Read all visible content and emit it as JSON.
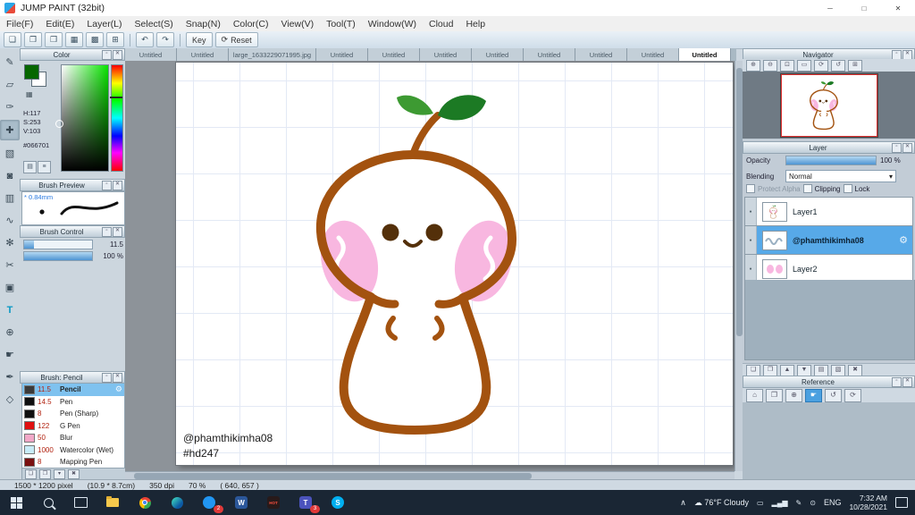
{
  "window": {
    "title": "JUMP PAINT (32bit)",
    "minimize_icon": "─",
    "maximize_icon": "□",
    "close_icon": "✕"
  },
  "panel": {
    "collapse_icon": "▫",
    "close_icon": "✕"
  },
  "menu": {
    "items": [
      "File(F)",
      "Edit(E)",
      "Layer(L)",
      "Select(S)",
      "Snap(N)",
      "Color(C)",
      "View(V)",
      "Tool(T)",
      "Window(W)",
      "Cloud",
      "Help"
    ]
  },
  "toolbar": {
    "icons": [
      "❏",
      "❐",
      "❒",
      "▦",
      "▩",
      "⊞"
    ],
    "undo_icon": "↶",
    "redo_icon": "↷",
    "key_label": "Key",
    "reset_icon": "⟳",
    "reset_label": "Reset"
  },
  "tabs": {
    "items": [
      "Untitled",
      "Untitled",
      "large_1633229071995.jpg",
      "Untitled",
      "Untitled",
      "Untitled",
      "Untitled",
      "Untitled",
      "Untitled",
      "Untitled",
      "Untitled"
    ]
  },
  "tools": [
    {
      "name": "brush",
      "glyph": "✎"
    },
    {
      "name": "eraser",
      "glyph": "▱"
    },
    {
      "name": "dropper",
      "glyph": "✑"
    },
    {
      "name": "move",
      "glyph": "✚"
    },
    {
      "name": "marquee",
      "glyph": "▧"
    },
    {
      "name": "fill",
      "glyph": "◙"
    },
    {
      "name": "gradient",
      "glyph": "▥"
    },
    {
      "name": "lasso",
      "glyph": "∿"
    },
    {
      "name": "magic-wand",
      "glyph": "✻"
    },
    {
      "name": "scissors",
      "glyph": "✂"
    },
    {
      "name": "stamp",
      "glyph": "▣"
    },
    {
      "name": "text",
      "glyph": "T"
    },
    {
      "name": "zoom",
      "glyph": "⊕"
    },
    {
      "name": "hand",
      "glyph": "☛"
    },
    {
      "name": "pen",
      "glyph": "✒"
    },
    {
      "name": "shape",
      "glyph": "◇"
    }
  ],
  "color_panel": {
    "title": "Color",
    "hue": "H:117",
    "saturation": "S:253",
    "value": "V:103",
    "hex": "#066701",
    "foreground_color": "#066701",
    "background_color": "#ffffff",
    "button_icons": [
      "▤",
      "≡"
    ]
  },
  "brush_preview": {
    "title": "Brush Preview",
    "size_label": "* 0.84mm"
  },
  "brush_control": {
    "title": "Brush Control",
    "size_value": "11.5",
    "opacity_value": "100 %"
  },
  "brush_panel": {
    "title": "Brush: Pencil",
    "gear_icon": "⚙",
    "brushes": [
      {
        "size": "11.5",
        "name": "Pencil",
        "swatch": "#3a3a3a"
      },
      {
        "size": "14.5",
        "name": "Pen",
        "swatch": "#101010"
      },
      {
        "size": "8",
        "name": "Pen (Sharp)",
        "swatch": "#101010"
      },
      {
        "size": "122",
        "name": "G Pen",
        "swatch": "#e01010"
      },
      {
        "size": "50",
        "name": "Blur",
        "swatch": "#f2a8c8"
      },
      {
        "size": "1000",
        "name": "Watercolor (Wet)",
        "swatch": "#c8ecf8"
      },
      {
        "size": "8",
        "name": "Mapping Pen",
        "swatch": "#7a1010"
      }
    ]
  },
  "canvas": {
    "signature": "@phamthikimha08",
    "hashtag": "#hd247"
  },
  "navigator": {
    "title": "Navigator",
    "buttons": [
      "⊕",
      "⊖",
      "⊡",
      "▭",
      "⟳",
      "↺",
      "⊞"
    ]
  },
  "layer_panel": {
    "title": "Layer",
    "opacity_label": "Opacity",
    "opacity_value": "100 %",
    "blending_label": "Blending",
    "blending_value": "Normal",
    "dropdown_caret": "▾",
    "check_protect_alpha": "Protect Alpha",
    "check_clipping": "Clipping",
    "check_lock": "Lock",
    "visibility_icon": "●",
    "gear_icon": "⚙",
    "layers": [
      {
        "name": "Layer1"
      },
      {
        "name": "@phamthikimha08"
      },
      {
        "name": "Layer2"
      }
    ],
    "buttons": [
      "❏",
      "❐",
      "▲",
      "▼",
      "▤",
      "▧",
      "✖"
    ]
  },
  "reference_panel": {
    "title": "Reference",
    "buttons": [
      "⌂",
      "❐",
      "⊕",
      "☛",
      "↺",
      "⟳"
    ]
  },
  "status_bar": {
    "canvas_size": "1500 * 1200 pixel",
    "print_size": "(10.9 * 8.7cm)",
    "dpi": "350 dpi",
    "zoom": "70 %",
    "cursor": "( 640, 657 )"
  },
  "taskbar": {
    "caret": "∧",
    "weather_icon": "☁",
    "weather": "76°F Cloudy",
    "language": "ENG",
    "time": "7:32 AM",
    "date": "10/28/2021",
    "badge_chat": "2",
    "badge_teams": "3",
    "hot_label": "HOT",
    "word_letter": "W",
    "teams_letter": "T",
    "skype_letter": "S",
    "tray_icons": [
      {
        "name": "battery",
        "glyph": "▭"
      },
      {
        "name": "network",
        "glyph": "▂▄▆"
      },
      {
        "name": "pen",
        "glyph": "✎"
      },
      {
        "name": "mic",
        "glyph": "⊙"
      }
    ]
  }
}
